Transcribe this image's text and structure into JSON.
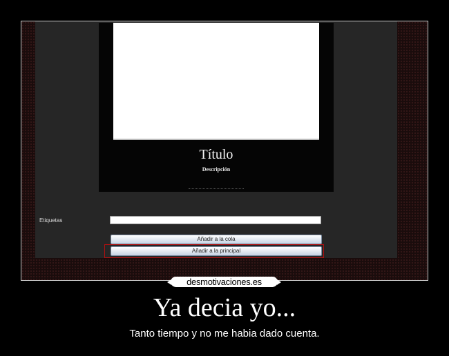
{
  "preview": {
    "title": "Título",
    "description": "Descripción"
  },
  "form": {
    "tags_label": "Etiquetas",
    "tags_value": "",
    "queue_button": "Añadir a la cola",
    "main_button": "Añadir a la principal"
  },
  "poster": {
    "logo": "desmotivaciones.es",
    "headline": "Ya decia yo...",
    "caption": "Tanto tiempo y no me habia dado cuenta."
  }
}
